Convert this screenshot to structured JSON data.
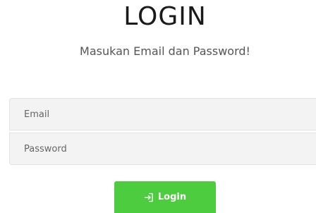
{
  "header": {
    "title": "LOGIN",
    "subtitle": "Masukan Email dan Password!"
  },
  "form": {
    "email_placeholder": "Email",
    "password_placeholder": "Password",
    "submit_label": "Login",
    "submit_icon": "login-icon",
    "submit_color": "#4ccc3e"
  }
}
